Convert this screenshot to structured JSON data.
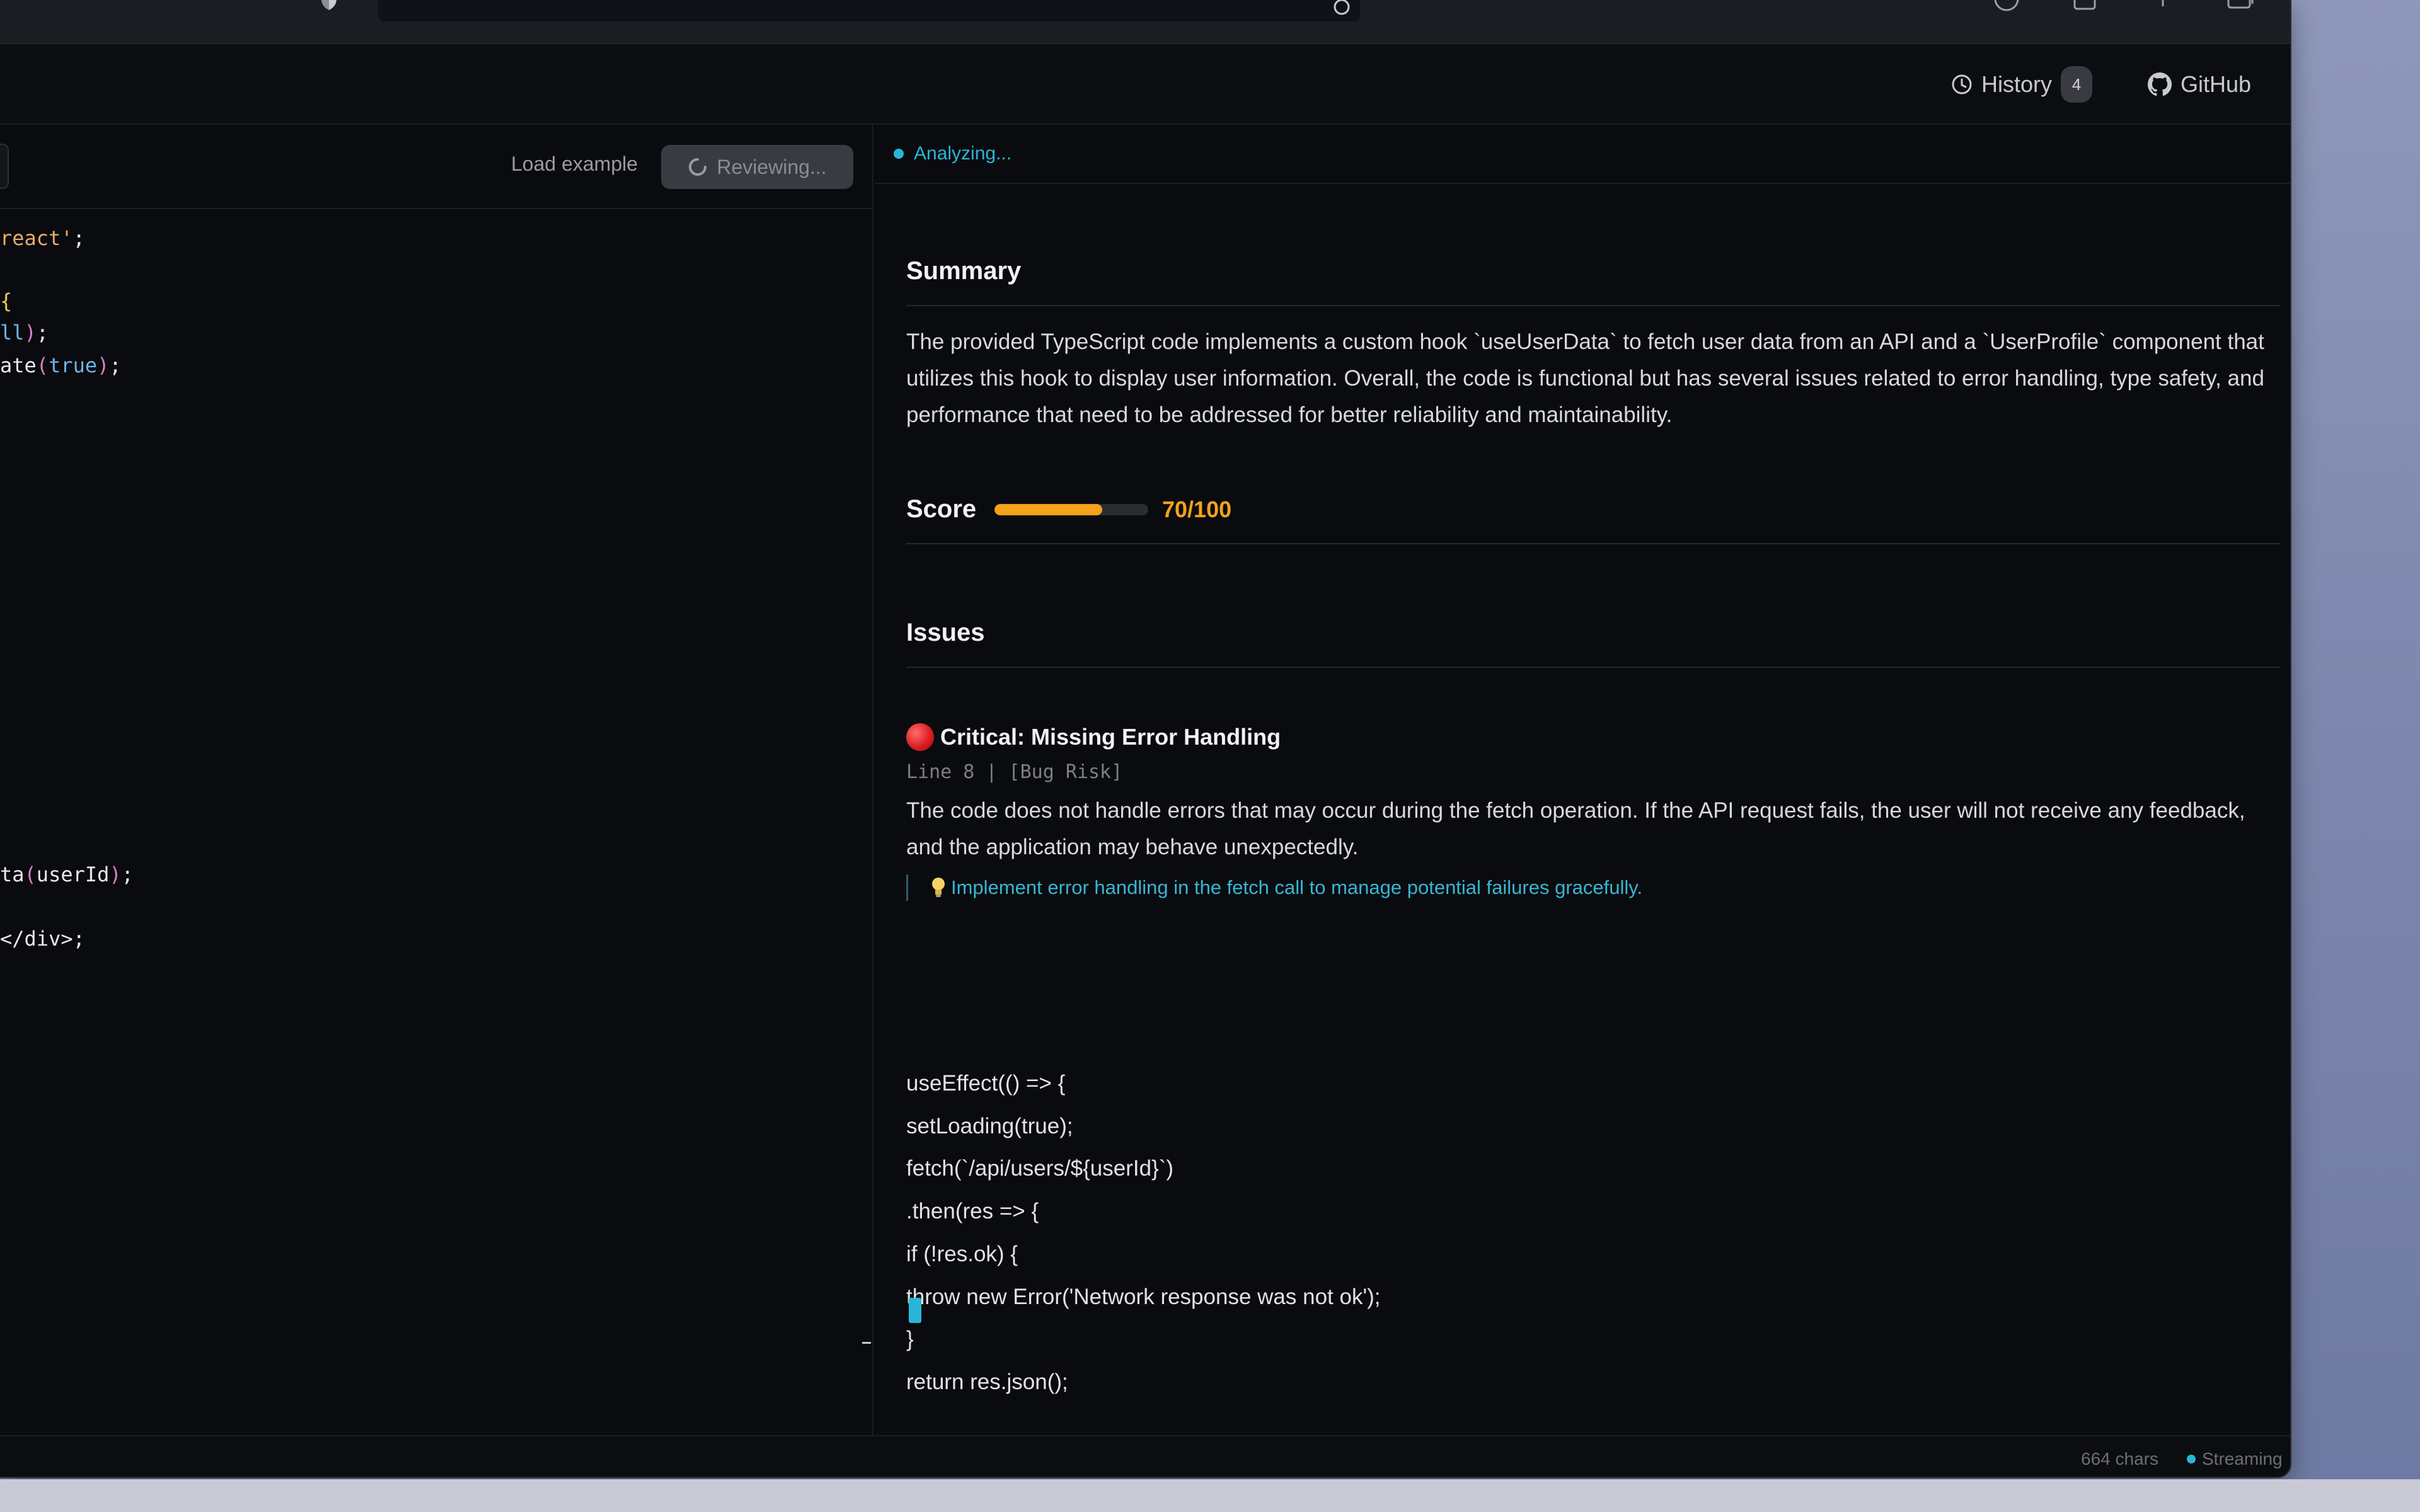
{
  "header": {
    "history_label": "History",
    "history_count": "4",
    "github_label": "GitHub"
  },
  "editor": {
    "load_example_label": "Load example",
    "review_button_label": "Reviewing..."
  },
  "status": {
    "text": "Analyzing..."
  },
  "review": {
    "summary_heading": "Summary",
    "summary_text": "The provided TypeScript code implements a custom hook `useUserData` to fetch user data from an API and a `UserProfile` component that utilizes this hook to display user information. Overall, the code is functional but has several issues related to error handling, type safety, and performance that need to be addressed for better reliability and maintainability.",
    "score_heading": "Score",
    "score_text": "70/100",
    "score_value": 70,
    "score_max": 100,
    "issues_heading": "Issues",
    "issue": {
      "title": "Critical: Missing Error Handling",
      "meta": "Line 8 | [Bug Risk]",
      "description": "The code does not handle errors that may occur during the fetch operation. If the API request fails, the user will not receive any feedback, and the application may behave unexpectedly.",
      "suggestion": "Implement error handling in the fetch call to manage potential failures gracefully.",
      "code_lines": [
        "useEffect(() => {",
        "setLoading(true);",
        "fetch(`/api/users/${userId}`)",
        ".then(res => {",
        "if (!res.ok) {",
        "throw new Error('Network response was not ok');",
        "}",
        "return res.json();"
      ]
    }
  },
  "footer": {
    "chars": "664 chars",
    "streaming": "Streaming"
  },
  "colors": {
    "accent": "#29b6d6",
    "score": "#f4a21a",
    "critical": "#d9191e",
    "background": "#0a0b0f"
  }
}
